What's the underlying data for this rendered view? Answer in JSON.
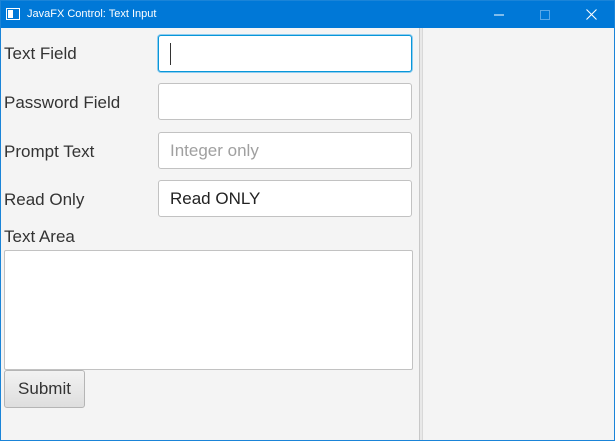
{
  "window": {
    "title": "JavaFX Control: Text Input",
    "accent_color": "#0078d7",
    "controls": [
      "minimize-icon",
      "maximize-icon",
      "close-icon"
    ]
  },
  "form": {
    "text_field": {
      "label": "Text Field",
      "value": ""
    },
    "password_field": {
      "label": "Password Field",
      "value": ""
    },
    "prompt_text": {
      "label": "Prompt Text",
      "placeholder": "Integer only"
    },
    "read_only": {
      "label": "Read Only",
      "value": "Read ONLY"
    },
    "text_area": {
      "label": "Text Area",
      "value": ""
    },
    "submit_label": "Submit"
  }
}
